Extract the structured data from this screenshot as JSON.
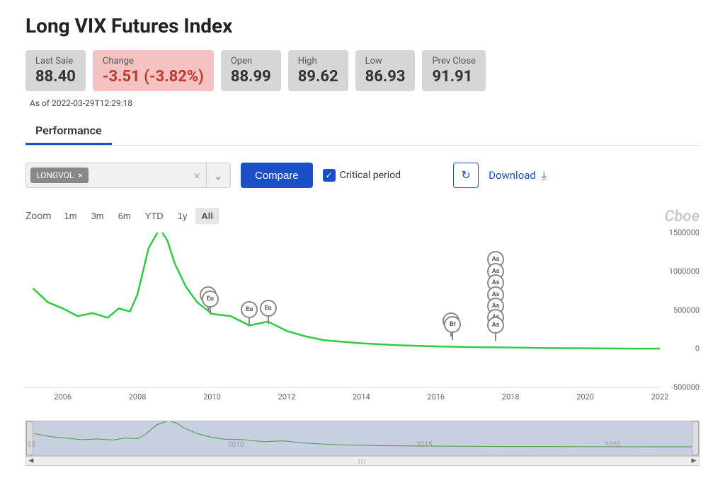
{
  "title": "Long VIX Futures Index",
  "stats": {
    "last_sale": {
      "label": "Last Sale",
      "value": "88.40"
    },
    "change": {
      "label": "Change",
      "value": "-3.51 (-3.82%)"
    },
    "open": {
      "label": "Open",
      "value": "88.99"
    },
    "high": {
      "label": "High",
      "value": "89.62"
    },
    "low": {
      "label": "Low",
      "value": "86.93"
    },
    "prev_close": {
      "label": "Prev Close",
      "value": "91.91"
    }
  },
  "asof": "As of 2022-03-29T12:29:18",
  "tab": "Performance",
  "symbol_chip": "LONGVOL",
  "compare_btn": "Compare",
  "critical_label": "Critical period",
  "download_label": "Download",
  "zoom": {
    "label": "Zoom",
    "options": [
      "1m",
      "3m",
      "6m",
      "YTD",
      "1y",
      "All"
    ],
    "active": "All"
  },
  "brand": "Cboe",
  "chart_data": {
    "type": "line",
    "title": "Long VIX Futures Index performance",
    "xlabel": "",
    "ylabel": "",
    "ylim": [
      -500000,
      1500000
    ],
    "yticks": [
      -500000,
      0,
      500000,
      1000000,
      1500000
    ],
    "xticks": [
      2006,
      2008,
      2010,
      2012,
      2014,
      2016,
      2018,
      2020,
      2022
    ],
    "x_range": [
      2005,
      2022
    ],
    "series": [
      {
        "name": "LONGVOL",
        "color": "#2ecc40",
        "x": [
          2005.2,
          2005.6,
          2006,
          2006.4,
          2006.8,
          2007.2,
          2007.5,
          2007.8,
          2008.0,
          2008.3,
          2008.6,
          2008.8,
          2009.0,
          2009.3,
          2009.6,
          2010.0,
          2010.5,
          2011.0,
          2011.5,
          2012.0,
          2012.5,
          2013.0,
          2014.0,
          2015.0,
          2016.0,
          2017.0,
          2018.0,
          2019.0,
          2020.0,
          2021.0,
          2022.0
        ],
        "y": [
          780000,
          600000,
          520000,
          420000,
          460000,
          400000,
          520000,
          480000,
          700000,
          1300000,
          1550000,
          1400000,
          1100000,
          800000,
          600000,
          450000,
          420000,
          300000,
          350000,
          230000,
          160000,
          110000,
          70000,
          45000,
          30000,
          20000,
          15000,
          8000,
          5000,
          2000,
          1000
        ]
      }
    ],
    "annotations": [
      {
        "label": "Eu",
        "x": 2009.9,
        "y": 500000
      },
      {
        "label": "Eu",
        "x": 2009.95,
        "y": 440000
      },
      {
        "label": "Eu",
        "x": 2011.0,
        "y": 300000
      },
      {
        "label": "Eu",
        "x": 2011.5,
        "y": 320000
      },
      {
        "label": "Br",
        "x": 2016.4,
        "y": 160000
      },
      {
        "label": "Br",
        "x": 2016.45,
        "y": 110000
      },
      {
        "label": "As",
        "x": 2017.6,
        "y": 950000
      },
      {
        "label": "As",
        "x": 2017.6,
        "y": 800000
      },
      {
        "label": "As",
        "x": 2017.6,
        "y": 650000
      },
      {
        "label": "As",
        "x": 2017.6,
        "y": 500000
      },
      {
        "label": "As",
        "x": 2017.6,
        "y": 350000
      },
      {
        "label": "As",
        "x": 2017.6,
        "y": 200000
      },
      {
        "label": "As",
        "x": 2017.6,
        "y": 100000
      }
    ]
  },
  "navigator": {
    "labels": [
      "'05",
      "2010",
      "2015",
      "2020"
    ]
  }
}
